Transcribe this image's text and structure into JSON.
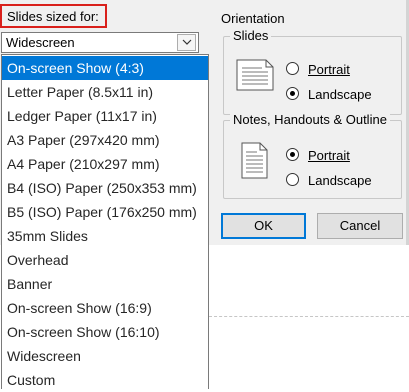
{
  "slide_size": {
    "label": "Slides sized for:",
    "selected_value": "Widescreen",
    "options": [
      {
        "label": "On-screen Show (4:3)",
        "highlighted": true
      },
      {
        "label": "Letter Paper (8.5x11 in)",
        "highlighted": false
      },
      {
        "label": "Ledger Paper (11x17 in)",
        "highlighted": false
      },
      {
        "label": "A3 Paper (297x420 mm)",
        "highlighted": false
      },
      {
        "label": "A4 Paper (210x297 mm)",
        "highlighted": false
      },
      {
        "label": "B4 (ISO) Paper (250x353 mm)",
        "highlighted": false
      },
      {
        "label": "B5 (ISO) Paper (176x250 mm)",
        "highlighted": false
      },
      {
        "label": "35mm Slides",
        "highlighted": false
      },
      {
        "label": "Overhead",
        "highlighted": false
      },
      {
        "label": "Banner",
        "highlighted": false
      },
      {
        "label": "On-screen Show (16:9)",
        "highlighted": false
      },
      {
        "label": "On-screen Show (16:10)",
        "highlighted": false
      },
      {
        "label": "Widescreen",
        "highlighted": false
      },
      {
        "label": "Custom",
        "highlighted": false
      }
    ]
  },
  "orientation": {
    "title": "Orientation",
    "slides": {
      "title": "Slides",
      "icon": "landscape-page-icon",
      "portrait_label": "Portrait",
      "landscape_label": "Landscape",
      "selected": "landscape"
    },
    "notes": {
      "title": "Notes, Handouts & Outline",
      "icon": "portrait-page-icon",
      "portrait_label": "Portrait",
      "landscape_label": "Landscape",
      "selected": "portrait"
    }
  },
  "buttons": {
    "ok_label": "OK",
    "cancel_label": "Cancel"
  },
  "colors": {
    "highlight": "#0078d7",
    "callout_border": "#d9201b",
    "dialog_bg": "#f0f0f0"
  }
}
